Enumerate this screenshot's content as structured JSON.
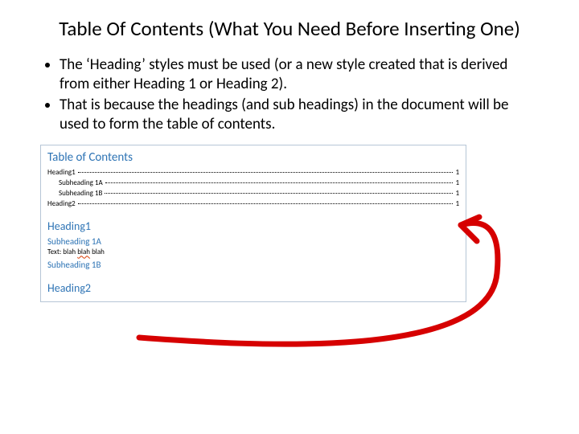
{
  "title": "Table Of Contents (What You Need Before Inserting One)",
  "bullets": [
    "The ‘Heading’ styles must be used (or a new style created that is derived from either Heading 1 or Heading 2).",
    "That is because the headings (and sub headings) in the document will be used to form the table of contents."
  ],
  "preview": {
    "toc_title": "Table of Contents",
    "toc_entries": [
      {
        "label": "Heading1",
        "page": "1",
        "indent": 0
      },
      {
        "label": "Subheading 1A",
        "page": "1",
        "indent": 1
      },
      {
        "label": "Subheading 1B",
        "page": "1",
        "indent": 1
      },
      {
        "label": "Heading2",
        "page": "1",
        "indent": 0
      }
    ],
    "sections": {
      "h1a": "Heading1",
      "h2a": "Subheading 1A",
      "body_prefix": "Text: blah ",
      "body_wavy": "blah",
      "body_suffix": " blah",
      "h2b": "Subheading 1B",
      "h1b": "Heading2"
    }
  },
  "colors": {
    "heading_blue": "#2e74b5",
    "annotation_red": "#d60000"
  }
}
